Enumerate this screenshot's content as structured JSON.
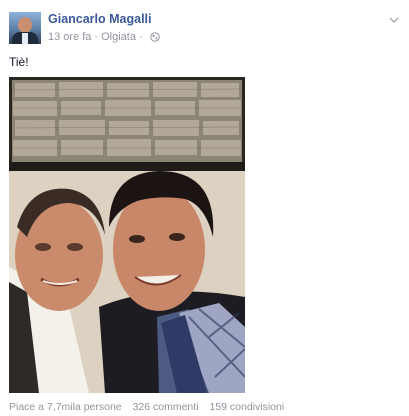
{
  "post": {
    "author": "Giancarlo Magalli",
    "time": "13 ore fa",
    "separator": "·",
    "location": "Olgiata",
    "text": "Tiè!",
    "icons": {
      "avatar": "profile-photo",
      "privacy": "globe-icon",
      "menu": "chevron-down-icon"
    }
  },
  "photo": {
    "subject": "selfie"
  },
  "footer": {
    "likes": "Piace a 7,7mila persone",
    "comments": "326 commenti",
    "shares": "159 condivisioni"
  },
  "colors": {
    "author_link": "#3b5998",
    "meta_text": "#90949c",
    "background": "#ffffff"
  }
}
